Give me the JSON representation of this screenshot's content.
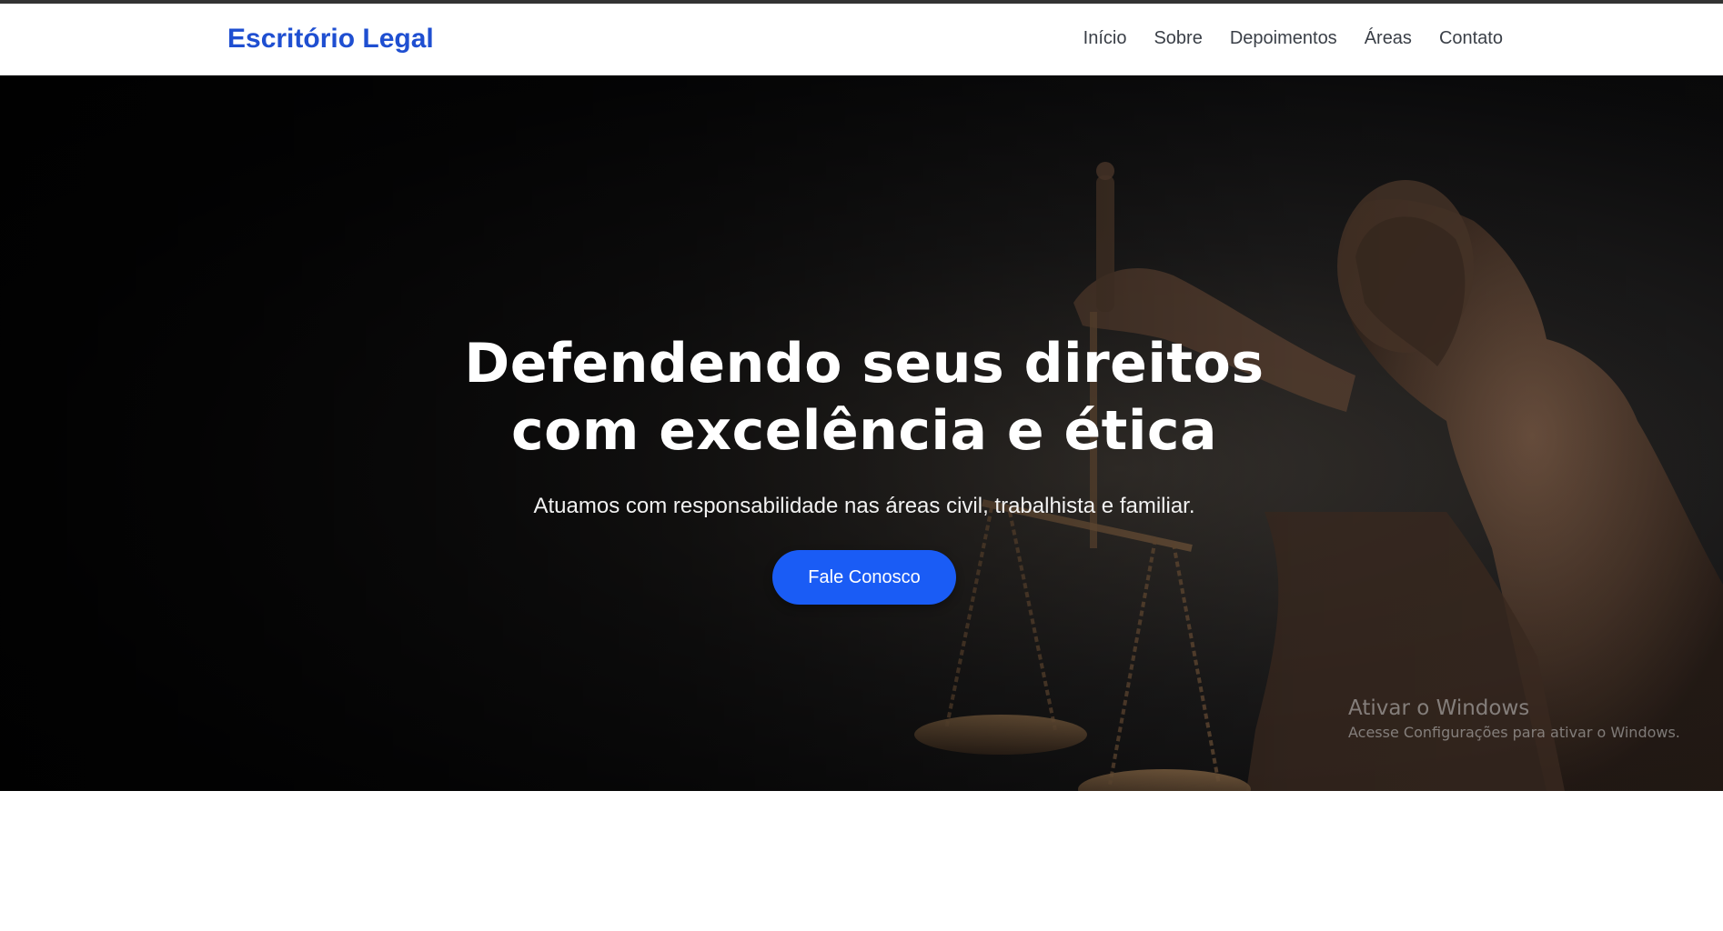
{
  "brand": {
    "name": "Escritório Legal",
    "color": "#1f4fd1"
  },
  "nav": {
    "items": [
      {
        "label": "Início"
      },
      {
        "label": "Sobre"
      },
      {
        "label": "Depoimentos"
      },
      {
        "label": "Áreas"
      },
      {
        "label": "Contato"
      }
    ]
  },
  "hero": {
    "title_line1": "Defendendo seus direitos",
    "title_line2": "com excelência e ética",
    "subtitle": "Atuamos com responsabilidade nas áreas civil, trabalhista e familiar.",
    "cta_label": "Fale Conosco",
    "cta_color": "#1a5cf5",
    "background_image": "lady-justice-statue"
  },
  "watermark": {
    "title": "Ativar o Windows",
    "subtitle": "Acesse Configurações para ativar o Windows."
  }
}
